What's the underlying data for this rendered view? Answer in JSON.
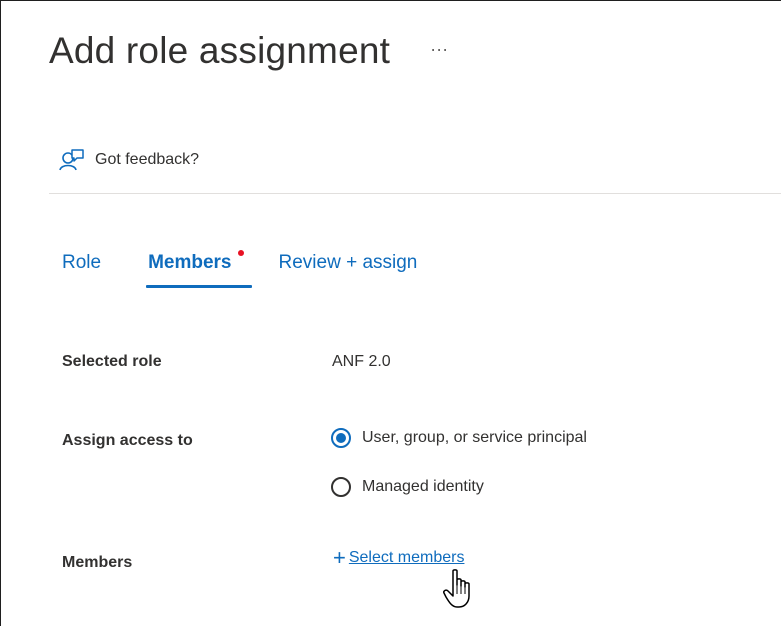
{
  "header": {
    "title": "Add role assignment",
    "more_label": "···"
  },
  "feedback": {
    "label": "Got feedback?",
    "icon": "feedback-person-icon"
  },
  "tabs": [
    {
      "label": "Role",
      "active": false
    },
    {
      "label": "Members",
      "active": true,
      "has_indicator": true
    },
    {
      "label": "Review + assign",
      "active": false
    }
  ],
  "form": {
    "selected_role_label": "Selected role",
    "selected_role_value": "ANF 2.0",
    "assign_access_label": "Assign access to",
    "assign_options": [
      {
        "label": "User, group, or service principal",
        "checked": true
      },
      {
        "label": "Managed identity",
        "checked": false
      }
    ],
    "members_label": "Members",
    "select_members_label": "Select members"
  },
  "colors": {
    "accent": "#0f6cbd",
    "indicator": "#e81123",
    "text": "#323130"
  }
}
